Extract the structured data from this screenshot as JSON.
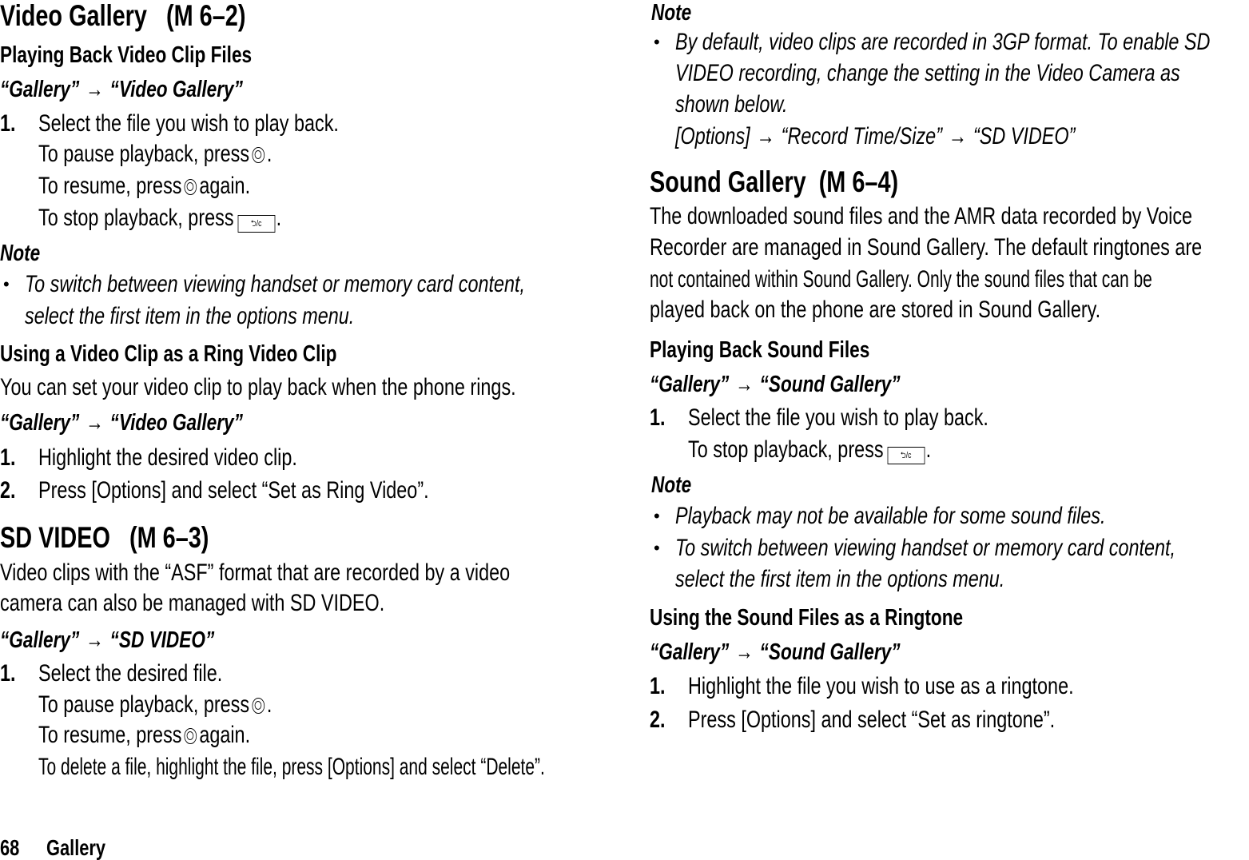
{
  "left_column": {
    "video_gallery": {
      "title": "Video Gallery",
      "menu_code": "(M 6–2)",
      "playing_back": {
        "heading": "Playing Back Video Clip Files",
        "path_from": "“Gallery”",
        "path_arrow": "→",
        "path_to": "“Video Gallery”",
        "step1_num": "1.",
        "step1_text": "Select the file you wish to play back.",
        "pause_text": "To pause playback, press",
        "pause_end": ".",
        "resume_text": "To resume, press",
        "resume_end": "again.",
        "stop_text": "To stop playback, press",
        "stop_end": ".",
        "back_key_label": "⮌/c"
      },
      "note": {
        "label": "Note",
        "bullet": "•",
        "line1": "To switch between viewing handset or memory card content,",
        "line2": "select the first item in the options menu."
      },
      "ring_video": {
        "heading": "Using a Video Clip as a Ring Video Clip",
        "intro": "You can set your video clip to play back when the phone rings.",
        "path_from": "“Gallery”",
        "path_arrow": "→",
        "path_to": "“Video Gallery”",
        "step1_num": "1.",
        "step1_text": "Highlight the desired video clip.",
        "step2_num": "2.",
        "step2_text": "Press [Options] and select “Set as Ring Video”."
      }
    },
    "sd_video": {
      "title": "SD VIDEO",
      "menu_code": "(M 6–3)",
      "intro_line1": "Video clips with the “ASF” format that are recorded by a video",
      "intro_line2": "camera can also be managed with SD VIDEO.",
      "path_from": "“Gallery”",
      "path_arrow": "→",
      "path_to": "“SD VIDEO”",
      "step1_num": "1.",
      "step1_text": "Select the desired file.",
      "pause_text": "To pause playback, press",
      "pause_end": ".",
      "resume_text": "To resume, press",
      "resume_end": "again.",
      "delete_text": "To delete a file, highlight the file, press [Options] and select “Delete”."
    }
  },
  "right_column": {
    "sd_note": {
      "label": "Note",
      "bullet": "•",
      "line1": "By default, video clips are recorded in 3GP format. To enable SD",
      "line2": "VIDEO recording, change the setting in the Video Camera as",
      "line3": "shown below.",
      "path_a": "[Options]",
      "arrow": "→",
      "path_b": "“Record Time/Size”",
      "path_c": "“SD VIDEO”"
    },
    "sound_gallery": {
      "title": "Sound Gallery",
      "menu_code": "(M 6–4)",
      "intro_line1": "The downloaded sound files and the AMR data recorded by Voice",
      "intro_line2": "Recorder are managed in Sound Gallery. The default ringtones are",
      "intro_line3": "not contained within Sound Gallery. Only the sound files that can be",
      "intro_line4": "played back on the phone are stored in Sound Gallery.",
      "playing_back": {
        "heading": "Playing Back Sound Files",
        "path_from": "“Gallery”",
        "path_arrow": "→",
        "path_to": "“Sound Gallery”",
        "step1_num": "1.",
        "step1_text": "Select the file you wish to play back.",
        "stop_text": "To stop playback, press",
        "stop_end": ".",
        "back_key_label": "⮌/c"
      },
      "note": {
        "label": "Note",
        "bullet": "•",
        "bullet1": "Playback may not be available for some sound files.",
        "bullet2_line1": "To switch between viewing handset or memory card content,",
        "bullet2_line2": "select the first item in the options menu."
      },
      "ringtone": {
        "heading": "Using the Sound Files as a Ringtone",
        "path_from": "“Gallery”",
        "path_arrow": "→",
        "path_to": "“Sound Gallery”",
        "step1_num": "1.",
        "step1_text": "Highlight the file you wish to use as a ringtone.",
        "step2_num": "2.",
        "step2_text": "Press [Options] and select “Set as ringtone”."
      }
    }
  },
  "footer": {
    "page_number": "68",
    "section": "Gallery"
  }
}
